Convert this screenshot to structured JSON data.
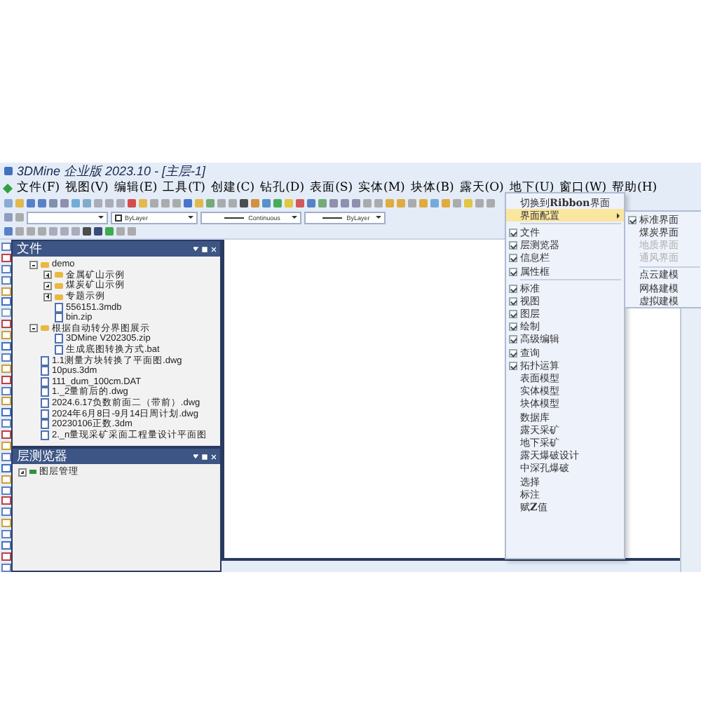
{
  "window": {
    "title": "3DMine 企业版 2023.10 - [主层-1]"
  },
  "menu": [
    "文件(F)",
    "视图(V)",
    "编辑(E)",
    "工具(T)",
    "创建(C)",
    "钻孔(D)",
    "表面(S)",
    "实体(M)",
    "块体(B)",
    "露天(O)",
    "地下(U)",
    "窗口(W)",
    "帮助(H)"
  ],
  "property_bar": {
    "color_setting": "ByLayer",
    "linetype": "Continuous",
    "lineweight": "ByLayer"
  },
  "file_panel": {
    "title": "文件",
    "tree": [
      {
        "label": "demo",
        "kind": "folder",
        "expanded": true,
        "children": [
          {
            "label": "金属矿山示例",
            "kind": "folder",
            "expanded": false
          },
          {
            "label": "煤炭矿山示例",
            "kind": "folder",
            "expanded": false
          },
          {
            "label": "专题示例",
            "kind": "folder",
            "expanded": false
          },
          {
            "label": "556151.3mdb",
            "kind": "file"
          },
          {
            "label": "bin.zip",
            "kind": "file"
          }
        ]
      },
      {
        "label": "根据自动转分界图展示",
        "kind": "folder",
        "expanded": true,
        "children": [
          {
            "label": "3DMine V202305.zip",
            "kind": "file"
          },
          {
            "label": "生成底图转换方式.bat",
            "kind": "file"
          }
        ]
      },
      {
        "label": "1.1测量方块转换了平面图.dwg",
        "kind": "file"
      },
      {
        "label": "10pus.3dm",
        "kind": "file"
      },
      {
        "label": "111_dum_100cm.DAT",
        "kind": "file"
      },
      {
        "label": "1._2量前后的.dwg",
        "kind": "file"
      },
      {
        "label": "2024.6.17负数前面二（带前）.dwg",
        "kind": "file"
      },
      {
        "label": "2024年6月8日-9月14日周计划.dwg",
        "kind": "file"
      },
      {
        "label": "20230106正数.3dm",
        "kind": "file"
      },
      {
        "label": "2._n量现采矿采面工程量设计平面图",
        "kind": "file"
      }
    ]
  },
  "layer_panel": {
    "title": "层测览器",
    "tree": [
      {
        "label": "图层管理"
      }
    ]
  },
  "context_menu": [
    {
      "kind": "plain",
      "label": "切换到**Ribbon**界面"
    },
    {
      "kind": "submenu",
      "label": "界面配置",
      "selected": true
    },
    {
      "kind": "separator"
    },
    {
      "kind": "toggle",
      "label": "文件",
      "checked": true
    },
    {
      "kind": "toggle",
      "label": "层测览器",
      "checked": true
    },
    {
      "kind": "toggle",
      "label": "信息栏",
      "checked": true
    },
    {
      "kind": "toggle",
      "label": "属性框",
      "checked": true
    },
    {
      "kind": "separator"
    },
    {
      "kind": "toggle",
      "label": "标准",
      "checked": true
    },
    {
      "kind": "toggle",
      "label": "视图",
      "checked": true
    },
    {
      "kind": "toggle",
      "label": "图层",
      "checked": true
    },
    {
      "kind": "toggle",
      "label": "绘制",
      "checked": true
    },
    {
      "kind": "toggle",
      "label": "高级编辑",
      "checked": true
    },
    {
      "kind": "toggle",
      "label": "查询",
      "checked": true
    },
    {
      "kind": "toggle",
      "label": "拓扑运算",
      "checked": true
    },
    {
      "kind": "toggle",
      "label": "表面模型",
      "checked": false
    },
    {
      "kind": "toggle",
      "label": "实体模型",
      "checked": false
    },
    {
      "kind": "toggle",
      "label": "块体模型",
      "checked": false
    },
    {
      "kind": "toggle",
      "label": "数据库",
      "checked": false
    },
    {
      "kind": "toggle",
      "label": "露天采矿",
      "checked": false
    },
    {
      "kind": "toggle",
      "label": "地下采矿",
      "checked": false
    },
    {
      "kind": "toggle",
      "label": "露天爆破设计",
      "checked": false
    },
    {
      "kind": "toggle",
      "label": "中深孔爆破",
      "checked": false
    },
    {
      "kind": "toggle",
      "label": "选择",
      "checked": false
    },
    {
      "kind": "toggle",
      "label": "标注",
      "checked": false
    },
    {
      "kind": "toggle",
      "label": "赋**Z**值",
      "checked": false
    }
  ],
  "submenu": [
    {
      "kind": "toggle",
      "label": "标准界面",
      "checked": true,
      "disabled": false
    },
    {
      "kind": "toggle",
      "label": "煤炭界面",
      "checked": false,
      "disabled": false
    },
    {
      "kind": "toggle",
      "label": "地质界面",
      "checked": false,
      "disabled": true
    },
    {
      "kind": "toggle",
      "label": "通风界面",
      "checked": false,
      "disabled": true
    },
    {
      "kind": "separator"
    },
    {
      "kind": "toggle",
      "label": "点云建模",
      "checked": false,
      "disabled": false
    },
    {
      "kind": "toggle",
      "label": "网格建模",
      "checked": false,
      "disabled": false
    },
    {
      "kind": "toggle",
      "label": "虚拟建模",
      "checked": false,
      "disabled": false
    }
  ]
}
